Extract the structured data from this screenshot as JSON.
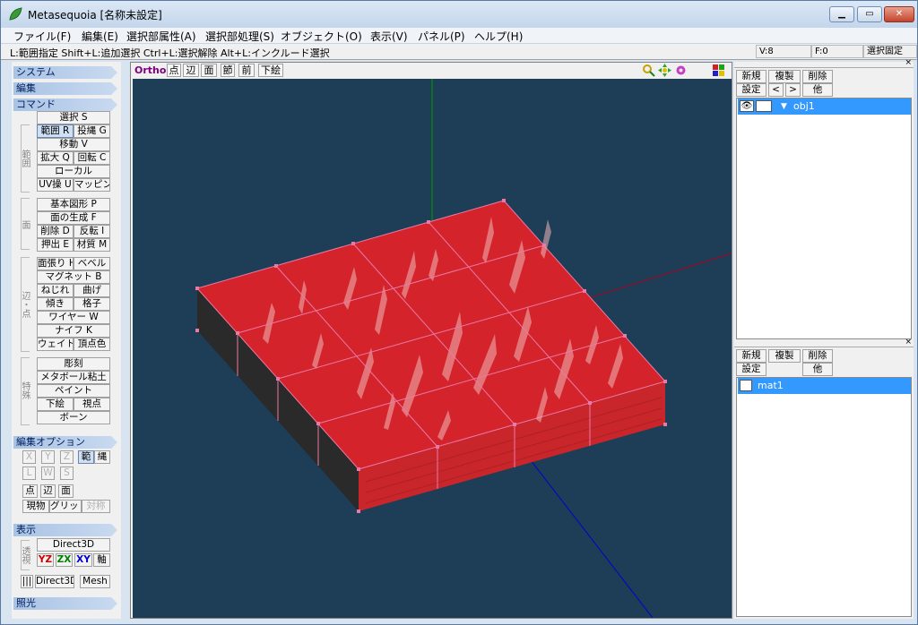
{
  "window": {
    "title": "Metasequoia [名称未設定]",
    "min_glyph": "▁",
    "max_glyph": "▭",
    "close_glyph": "✕"
  },
  "menu": [
    "ファイル(F)",
    "編集(E)",
    "選択部属性(A)",
    "選択部処理(S)",
    "オブジェクト(O)",
    "表示(V)",
    "パネル(P)",
    "ヘルプ(H)"
  ],
  "hint": {
    "text": "L:範囲指定  Shift+L:追加選択  Ctrl+L:選択解除  Alt+L:インクルード選択",
    "vertices": "V:8",
    "faces": "F:0",
    "lock": "選択固定"
  },
  "left": {
    "sections": {
      "system": "システム",
      "edit": "編集",
      "command": "コマンド",
      "edit_option": "編集オプション",
      "display": "表示",
      "light": "照光"
    },
    "group_labels": {
      "range": "範囲",
      "face": "面",
      "edge": "辺・点",
      "special": "特殊",
      "transparent": "透視"
    },
    "commands": {
      "select": "選択 S",
      "range": "範囲 R",
      "lasso": "投縄 G",
      "move": "移動 V",
      "scale": "拡大 Q",
      "rotate": "回転 C",
      "local": "ローカル",
      "uv": "UV操 U",
      "mapping": "マッピング",
      "basic_shape": "基本図形 P",
      "face_gen": "面の生成 F",
      "delete": "削除 D",
      "flip": "反転 I",
      "extrude": "押出 E",
      "material": "材質 M",
      "face_stretch": "面張り H",
      "bevel": "ベベル",
      "magnet": "マグネット B",
      "twist": "ねじれ",
      "bend": "曲げ",
      "tilt": "傾き",
      "lattice": "格子",
      "wire": "ワイヤー W",
      "knife": "ナイフ K",
      "weight": "ウェイト",
      "vertex_color": "頂点色",
      "sculpt": "彫刻",
      "metaball": "メタボール粘土",
      "paint": "ペイント",
      "underlay": "下絵",
      "viewpoint": "視点",
      "bone": "ボーン"
    },
    "options": {
      "x": "X",
      "y": "Y",
      "z": "Z",
      "range": "範",
      "lasso": "縄",
      "l": "L",
      "w": "W",
      "s": "S",
      "point": "点",
      "edge": "辺",
      "face": "面",
      "current": "現物",
      "grid": "グリッド",
      "symmetry": "対称"
    },
    "display": {
      "d3d": "Direct3D",
      "yz": "YZ",
      "zx": "ZX",
      "xy": "XY",
      "axis": "軸",
      "bars": "|||",
      "d3d2": "Direct3D",
      "mesh": "Mesh"
    }
  },
  "view": {
    "mode": "Ortho",
    "buttons": [
      "点",
      "辺",
      "面",
      "節",
      "前",
      "下絵"
    ]
  },
  "object_panel": {
    "new": "新規",
    "copy": "複製",
    "delete": "削除",
    "settings": "設定",
    "prev": "<",
    "next": ">",
    "other": "他",
    "items": [
      {
        "name": "obj1",
        "visible": true
      }
    ]
  },
  "material_panel": {
    "new": "新規",
    "copy": "複製",
    "delete": "削除",
    "settings": "設定",
    "other": "他",
    "items": [
      {
        "name": "mat1"
      }
    ]
  },
  "colors": {
    "accent": "#3399ff",
    "viewport_bg": "#1e3d57",
    "top": "#d4232b",
    "side": "#2a2a2a",
    "front": "#c8262b",
    "vertex": "#e87aa7"
  }
}
